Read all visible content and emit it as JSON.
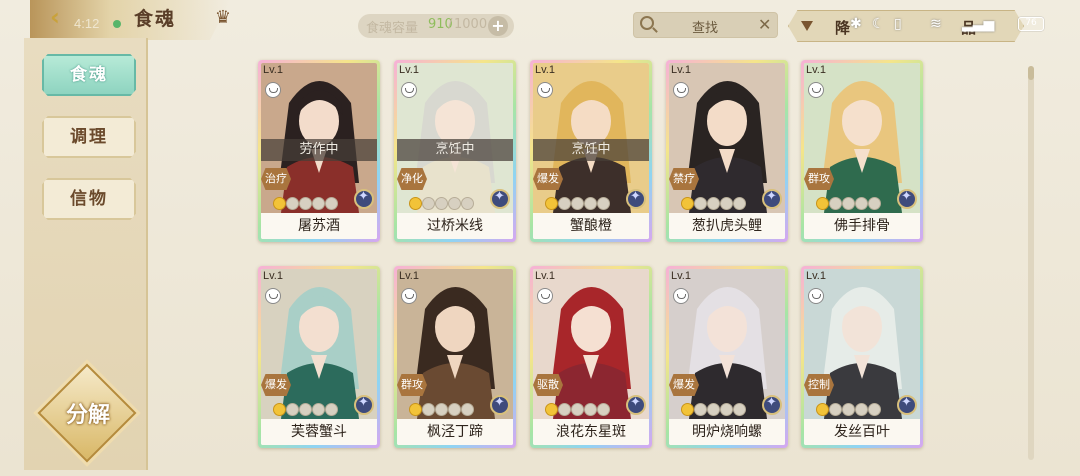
{
  "header": {
    "time": "4:12",
    "page_title": "食魂",
    "capacity": {
      "label": "食魂容量",
      "current": "910",
      "separator": "/",
      "max": "1000",
      "add_icon": "plus-icon"
    },
    "search": {
      "placeholder": "查找",
      "clear_icon": "close-icon"
    },
    "sort": {
      "label": "降",
      "label2": "品",
      "icon": "triangle-down-icon"
    },
    "system": {
      "battery": "76"
    }
  },
  "sidebar": {
    "items": [
      {
        "label": "食魂",
        "active": true
      },
      {
        "label": "调理",
        "active": false
      },
      {
        "label": "信物",
        "active": false
      }
    ],
    "decompose_label": "分解"
  },
  "cards": [
    {
      "name": "屠苏酒",
      "level": "Lv.1",
      "status": "劳作中",
      "role": "治疗",
      "stars_lit": 1,
      "hair": "#2b2120",
      "skin": "#f3dccb",
      "outfit": "#8a2f2a",
      "bg": "#c9a88c"
    },
    {
      "name": "过桥米线",
      "level": "Lv.1",
      "status": "烹饪中",
      "role": "净化",
      "stars_lit": 1,
      "hair": "#d8d8d0",
      "skin": "#f5e4d6",
      "outfit": "#e8e2cc",
      "bg": "#dfe6d2"
    },
    {
      "name": "蟹酿橙",
      "level": "Lv.1",
      "status": "烹饪中",
      "role": "爆发",
      "stars_lit": 1,
      "hair": "#e1b65c",
      "skin": "#f5dcc4",
      "outfit": "#3d2f2a",
      "bg": "#e9cc8a"
    },
    {
      "name": "葱扒虎头鲤",
      "level": "Lv.1",
      "status": "",
      "role": "禁疗",
      "stars_lit": 1,
      "hair": "#2a2422",
      "skin": "#f3dcc8",
      "outfit": "#2f2a2e",
      "bg": "#d8c6b4"
    },
    {
      "name": "佛手排骨",
      "level": "Lv.1",
      "status": "",
      "role": "群攻",
      "stars_lit": 1,
      "hair": "#e9c67e",
      "skin": "#f5e0cc",
      "outfit": "#2f6b4e",
      "bg": "#d5e2c6"
    },
    {
      "name": "芙蓉蟹斗",
      "level": "Lv.1",
      "status": "",
      "role": "爆发",
      "stars_lit": 1,
      "hair": "#a9cfc7",
      "skin": "#f3dfd0",
      "outfit": "#2c6b5c",
      "bg": "#d8d2c0"
    },
    {
      "name": "枫泾丁蹄",
      "level": "Lv.1",
      "status": "",
      "role": "群攻",
      "stars_lit": 1,
      "hair": "#3a2a20",
      "skin": "#efd6c0",
      "outfit": "#6a4a32",
      "bg": "#c9b498"
    },
    {
      "name": "浪花东星斑",
      "level": "Lv.1",
      "status": "",
      "role": "驱散",
      "stars_lit": 1,
      "hair": "#a8262a",
      "skin": "#f5e0d2",
      "outfit": "#8c2630",
      "bg": "#e8d8cc"
    },
    {
      "name": "明炉烧响螺",
      "level": "Lv.1",
      "status": "",
      "role": "爆发",
      "stars_lit": 1,
      "hair": "#e4e0e4",
      "skin": "#f3e2d8",
      "outfit": "#2e2a2e",
      "bg": "#d6cfcc"
    },
    {
      "name": "发丝百叶",
      "level": "Lv.1",
      "status": "",
      "role": "控制",
      "stars_lit": 1,
      "hair": "#e6ece8",
      "skin": "#f2e3d8",
      "outfit": "#3a3a3e",
      "bg": "#c9d8d6"
    }
  ],
  "colors": {
    "accent_teal": "#8ed4c0",
    "gold": "#d8c07c",
    "capacity_highlight": "#8fbd5c"
  }
}
